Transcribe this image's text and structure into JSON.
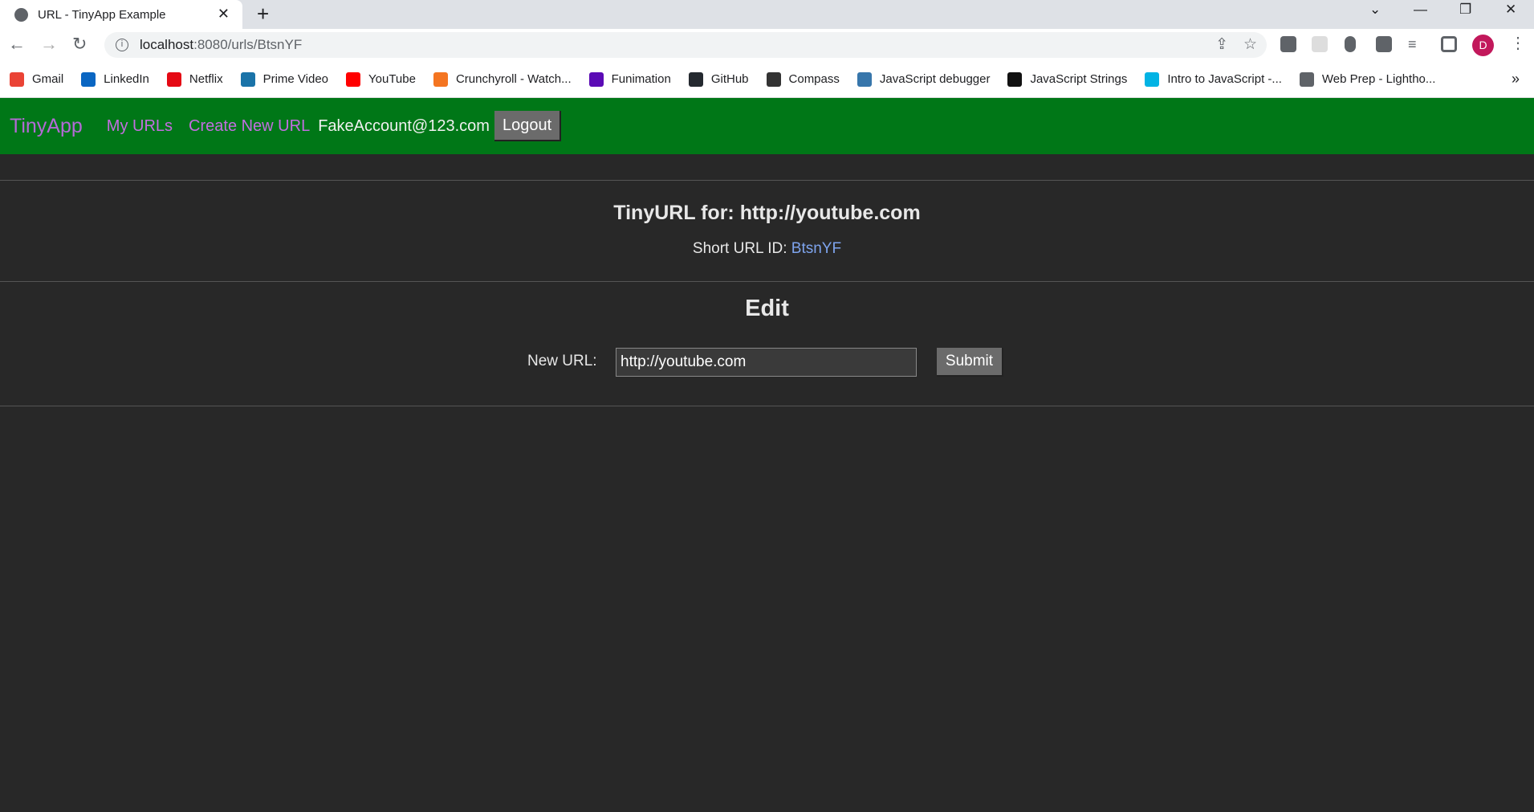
{
  "browser": {
    "tab_title": "URL - TinyApp Example",
    "url_host": "localhost",
    "url_path": ":8080/urls/BtsnYF",
    "profile_initial": "D",
    "bookmarks": [
      "Gmail",
      "LinkedIn",
      "Netflix",
      "Prime Video",
      "YouTube",
      "Crunchyroll - Watch...",
      "Funimation",
      "GitHub",
      "Compass",
      "JavaScript debugger",
      "JavaScript Strings",
      "Intro to JavaScript -...",
      "Web Prep - Lightho..."
    ],
    "bookmark_colors": [
      "#ea4335",
      "#0a66c2",
      "#e50914",
      "#1a73a8",
      "#ff0000",
      "#f47521",
      "#5b0bb5",
      "#24292f",
      "#333333",
      "#3776ab",
      "#111111",
      "#02b3e4",
      "#5f6368"
    ]
  },
  "nav": {
    "brand": "TinyApp",
    "my_urls": "My URLs",
    "create": "Create New URL",
    "email": "FakeAccount@123.com",
    "logout": "Logout"
  },
  "main": {
    "title": "TinyURL for: http://youtube.com",
    "short_label": "Short URL ID: ",
    "short_id": "BtsnYF",
    "edit_heading": "Edit",
    "new_url_label": "New URL:",
    "new_url_value": "http://youtube.com",
    "submit": "Submit"
  }
}
